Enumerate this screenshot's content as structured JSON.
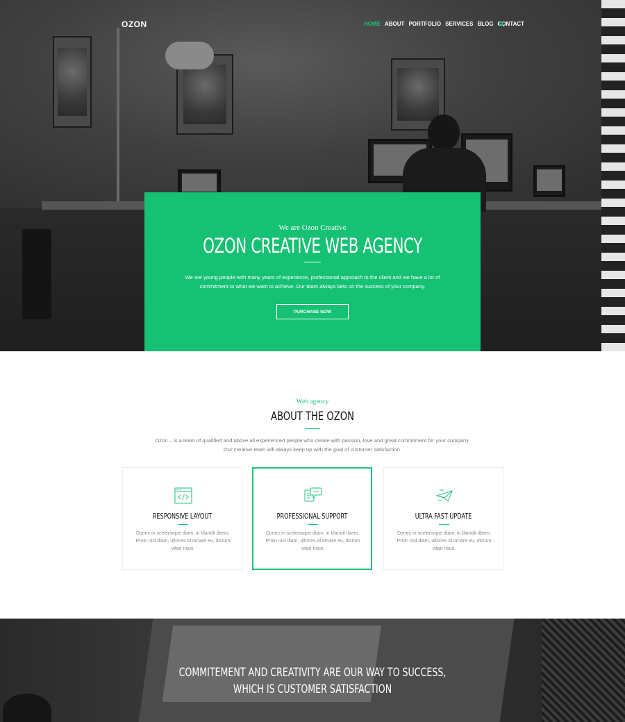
{
  "nav": {
    "logo": "OZON",
    "items": [
      {
        "label": "HOME",
        "active": true
      },
      {
        "label": "ABOUT",
        "active": false
      },
      {
        "label": "PORTFOLIO",
        "active": false
      },
      {
        "label": "SERVICES",
        "active": false
      },
      {
        "label": "BLOG",
        "active": false
      },
      {
        "label": "CONTACT",
        "active": false
      }
    ],
    "search_icon": "search-icon"
  },
  "hero": {
    "subtitle": "We are Ozon Creative",
    "title": "OZON CREATIVE WEB AGENCY",
    "text": "We are young people with many years of experience, professional approach to the client and we have a lot of commitment to what we want to achieve. Our team always bets on the success of your company.",
    "button": "PURCHASE NOW"
  },
  "about": {
    "subtitle": "Web agency",
    "title": "ABOUT THE OZON",
    "text": "Ozon – is a team of qualified and above all experienced people who create with passion, love and great commitment for your company. Our creative team will always keep up with the goal of customer satisfaction.",
    "cards": [
      {
        "icon": "code-window-icon",
        "title": "RESPONSIVE LAYOUT",
        "text": "Donec in scelerisque diam, in blandit libero. Proin nisl diam, ultrices id ornare eu, dictum vitae risus."
      },
      {
        "icon": "chat-support-icon",
        "title": "PROFESSIONAL SUPPORT",
        "text": "Donec in scelerisque diam, in blandit libero. Proin nisl diam, ultrices id ornare eu, dictum vitae risus."
      },
      {
        "icon": "paper-plane-icon",
        "title": "ULTRA FAST UPDATE",
        "text": "Donec in scelerisque diam, in blandit libero. Proin nisl diam, ultrices id ornare eu, dictum vitae risus."
      }
    ]
  },
  "band": {
    "line1": "COMMITEMENT AND CREATIVITY ARE OUR WAY TO SUCCESS,",
    "line2": "WHICH IS CUSTOMER SATISFACTION"
  },
  "colors": {
    "accent": "#16c174",
    "dark": "#111111",
    "muted": "#777777"
  }
}
